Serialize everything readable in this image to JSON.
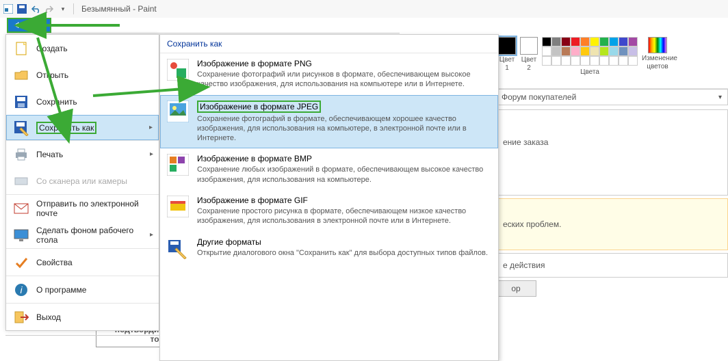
{
  "window": {
    "title": "Безымянный - Paint"
  },
  "file_tab": "Файл",
  "menu": {
    "create": "Создать",
    "open": "Открыть",
    "save": "Сохранить",
    "saveas": "Сохранить как",
    "print": "Печать",
    "scanner": "Со сканера или камеры",
    "email": "Отправить по электронной почте",
    "wallpaper": "Сделать фоном рабочего стола",
    "properties": "Свойства",
    "about": "О программе",
    "exit": "Выход"
  },
  "submenu": {
    "title": "Сохранить как",
    "png": {
      "t": "Изображение в формате PNG",
      "d": "Сохранение фотографий или рисунков в формате, обеспечивающем высокое качество изображения, для использования на компьютере или в Интернете."
    },
    "jpeg": {
      "t": "Изображение в формате JPEG",
      "d": "Сохранение фотографий в формате, обеспечивающем хорошее качество изображения, для использования на компьютере, в электронной почте или в Интернете."
    },
    "bmp": {
      "t": "Изображение в формате BMP",
      "d": "Сохранение любых изображений в формате, обеспечивающем высокое качество изображения, для использования на компьютере."
    },
    "gif": {
      "t": "Изображение в формате GIF",
      "d": "Сохранение простого рисунка в формате, обеспечивающем низкое качество изображения, для использования в электронной почте или в Интернете."
    },
    "other": {
      "t": "Другие форматы",
      "d": "Открытие диалогового окна \"Сохранить как\" для выбора доступных типов файлов."
    }
  },
  "ribbon": {
    "color1": "Цвет\n1",
    "color2": "Цвет\n2",
    "colors": "Цвета",
    "editcolors": "Изменение\nцветов"
  },
  "bg": {
    "forum": "Форум покупателей",
    "order": "ение заказа",
    "problem": "еских проблем.",
    "actions": "е действия",
    "btn": "ор",
    "bottom": "подтвордить получение товара"
  },
  "palette": {
    "row1": [
      "#000000",
      "#7f7f7f",
      "#880015",
      "#ed1c24",
      "#ff7f27",
      "#fff200",
      "#22b14c",
      "#00a2e8",
      "#3f48cc",
      "#a349a4"
    ],
    "row2": [
      "#ffffff",
      "#c3c3c3",
      "#b97a57",
      "#ffaec9",
      "#ffc90e",
      "#efe4b0",
      "#b5e61d",
      "#99d9ea",
      "#7092be",
      "#c8bfe7"
    ]
  }
}
